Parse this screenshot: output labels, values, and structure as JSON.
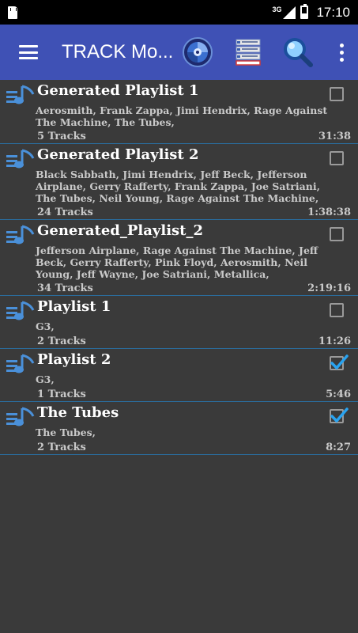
{
  "status_bar": {
    "network": "3G",
    "time": "17:10"
  },
  "app_bar": {
    "title": "TRACK Mo..."
  },
  "icons": {
    "sd": "sd-card-icon",
    "signal": "signal-icon",
    "battery": "battery-icon",
    "menu": "hamburger-menu-icon",
    "disc": "disc-icon",
    "playlist": "playlist-icon",
    "search": "search-icon",
    "more": "more-vert-icon",
    "row": "playlist-music-icon"
  },
  "colors": {
    "appbar": "#3f51b5",
    "background": "#3a3a3a",
    "divider": "#2a6d9e",
    "check": "#29a3f0"
  },
  "playlists": [
    {
      "title": "Generated Playlist 1",
      "artists": "Aerosmith, Frank Zappa, Jimi Hendrix, Rage Against The Machine, The Tubes,",
      "tracks": "5 Tracks",
      "duration": "31:38",
      "checked": false
    },
    {
      "title": "Generated Playlist 2",
      "artists": "Black Sabbath, Jimi Hendrix, Jeff Beck, Jefferson Airplane, Gerry Rafferty, Frank Zappa, Joe Satriani, The Tubes, Neil Young, Rage Against The Machine,",
      "tracks": "24 Tracks",
      "duration": "1:38:38",
      "checked": false
    },
    {
      "title": "Generated_Playlist_2",
      "artists": "Jefferson Airplane, Rage Against The Machine, Jeff Beck, Gerry Rafferty, Pink Floyd, Aerosmith, Neil Young, Jeff Wayne, Joe Satriani, Metallica,",
      "tracks": "34 Tracks",
      "duration": "2:19:16",
      "checked": false
    },
    {
      "title": "Playlist 1",
      "artists": "G3,",
      "tracks": "2 Tracks",
      "duration": "11:26",
      "checked": false
    },
    {
      "title": "Playlist 2",
      "artists": "G3,",
      "tracks": "1 Tracks",
      "duration": "5:46",
      "checked": true
    },
    {
      "title": "The Tubes",
      "artists": "The Tubes,",
      "tracks": "2 Tracks",
      "duration": "8:27",
      "checked": true
    }
  ]
}
